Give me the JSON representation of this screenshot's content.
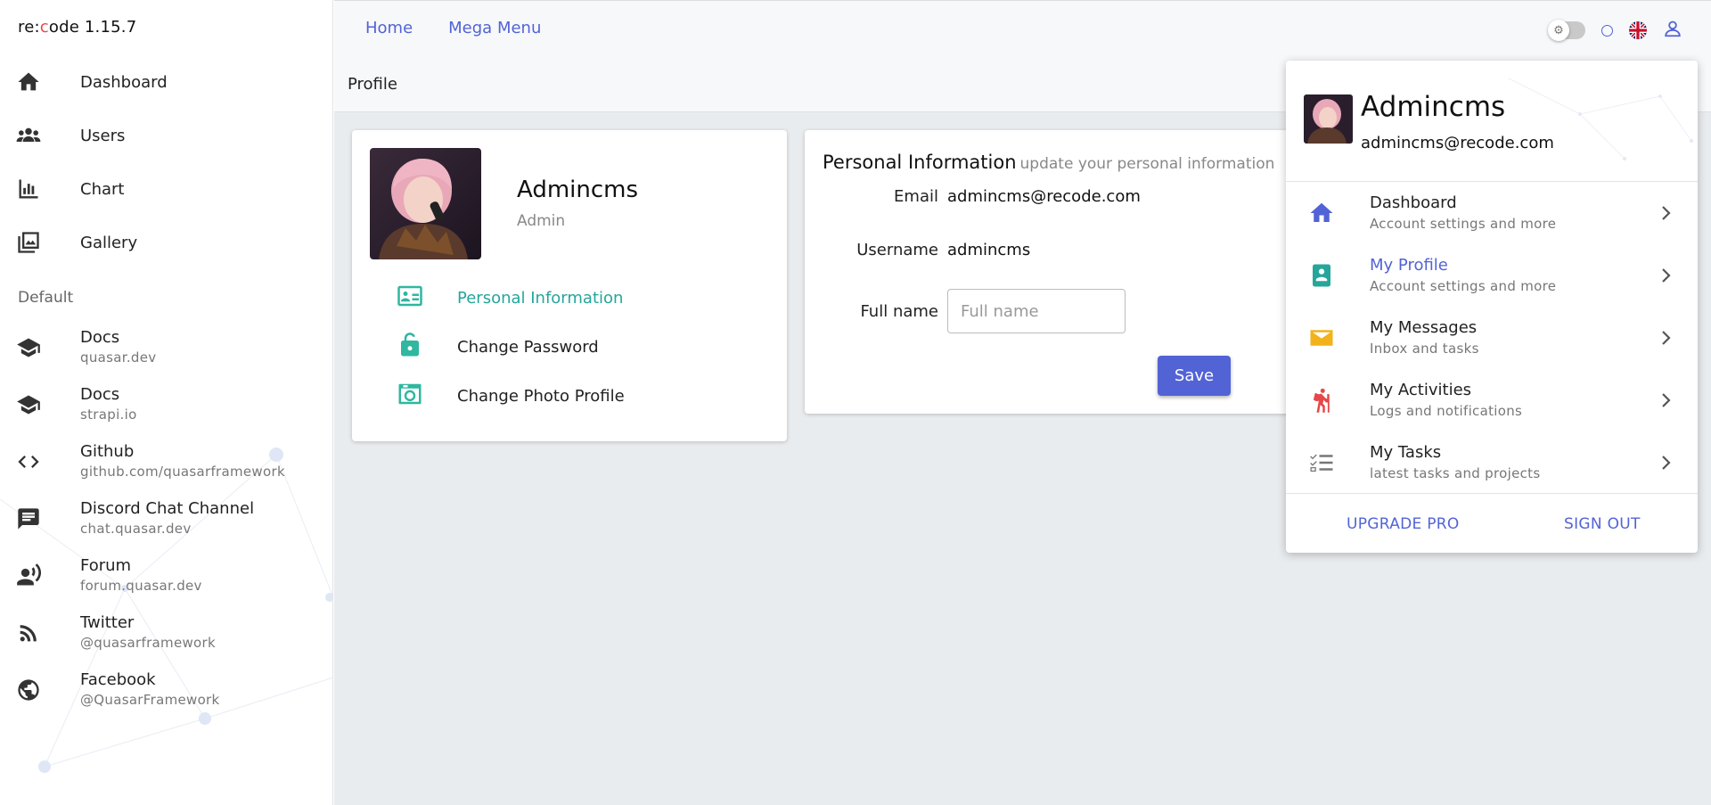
{
  "brand": {
    "prefix": "re:",
    "o": "c",
    "suffix": "ode 1.15.7"
  },
  "sidebar": {
    "nav": [
      {
        "label": "Dashboard",
        "icon": "home-icon"
      },
      {
        "label": "Users",
        "icon": "users-icon"
      },
      {
        "label": "Chart",
        "icon": "bar-chart-icon"
      },
      {
        "label": "Gallery",
        "icon": "gallery-icon"
      }
    ],
    "section_label": "Default",
    "links": [
      {
        "title": "Docs",
        "subtitle": "quasar.dev",
        "icon": "school-icon"
      },
      {
        "title": "Docs",
        "subtitle": "strapi.io",
        "icon": "school-icon"
      },
      {
        "title": "Github",
        "subtitle": "github.com/quasarframework",
        "icon": "code-icon"
      },
      {
        "title": "Discord Chat Channel",
        "subtitle": "chat.quasar.dev",
        "icon": "chat-icon"
      },
      {
        "title": "Forum",
        "subtitle": "forum.quasar.dev",
        "icon": "record-voice-icon"
      },
      {
        "title": "Twitter",
        "subtitle": "@quasarframework",
        "icon": "rss-icon"
      },
      {
        "title": "Facebook",
        "subtitle": "@QuasarFramework",
        "icon": "globe-icon"
      }
    ]
  },
  "topnav": {
    "home": "Home",
    "mega_menu": "Mega Menu"
  },
  "page": {
    "title": "Profile"
  },
  "profile_card": {
    "name": "Admincms",
    "role": "Admin",
    "menu": [
      {
        "label": "Personal Information",
        "icon": "id-card-icon"
      },
      {
        "label": "Change Password",
        "icon": "unlock-icon"
      },
      {
        "label": "Change Photo Profile",
        "icon": "camera-icon"
      }
    ]
  },
  "info_card": {
    "title": "Personal Information",
    "subtitle": "update your personal information",
    "email_label": "Email",
    "email_value": "admincms@recode.com",
    "username_label": "Username",
    "username_value": "admincms",
    "fullname_label": "Full name",
    "fullname_placeholder": "Full name",
    "save_label": "Save"
  },
  "dropdown": {
    "name": "Admincms",
    "email": "admincms@recode.com",
    "items": [
      {
        "title": "Dashboard",
        "subtitle": "Account settings and more",
        "icon": "home-icon",
        "color": "#5263d6"
      },
      {
        "title": "My Profile",
        "subtitle": "Account settings and more",
        "icon": "contact-badge-icon",
        "color": "#26a69a"
      },
      {
        "title": "My Messages",
        "subtitle": "Inbox and tasks",
        "icon": "mail-icon",
        "color": "#f2b21b"
      },
      {
        "title": "My Activities",
        "subtitle": "Logs and notifications",
        "icon": "hiking-icon",
        "color": "#e54848"
      },
      {
        "title": "My Tasks",
        "subtitle": "latest tasks and projects",
        "icon": "checklist-icon",
        "color": "#777777"
      }
    ],
    "upgrade_label": "UPGRADE PRO",
    "signout_label": "SIGN OUT"
  },
  "colors": {
    "primary": "#5263d6",
    "teal": "#26a69a",
    "page_bg": "#e9ecef"
  }
}
